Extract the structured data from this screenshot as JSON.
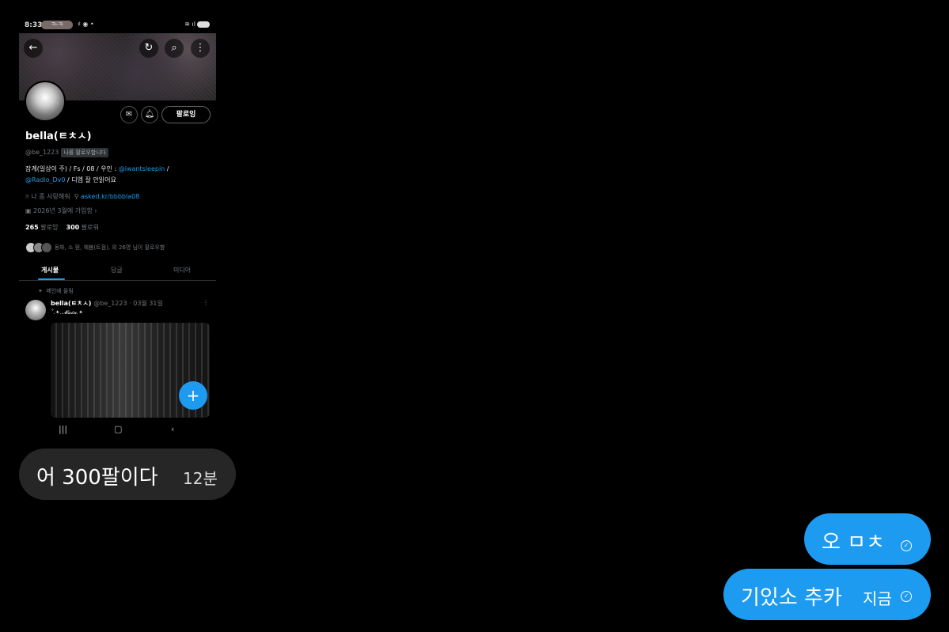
{
  "status_bar": {
    "time": "8:33",
    "pill_text": "ㅋ-ㅋ",
    "battery": "59"
  },
  "profile": {
    "name": "bella(ㅌㅊㅅ)",
    "handle": "@be_1223",
    "follows_you": "나를 팔로우합니다",
    "follow_button": "팔로잉",
    "bio_line1_prefix": "잡계(일상이 주) / Fs / 08 / 우인 :",
    "bio_link1": "@iwantsleepin",
    "bio_line1_suffix": "/",
    "bio_link2": "@Radio_Dv0",
    "bio_line2_suffix": "/ 디엠 잘 안읽어요",
    "location": "나 좀 사랑해줘",
    "website": "asked.kr/bbbbla08",
    "joined": "2026년 3월에 가입함",
    "following_count": "265",
    "following_label": "팔로잉",
    "followers_count": "300",
    "followers_label": "팔로워",
    "mutual_text": "동봐, 소 뭔, 혜봄(트점), 외 26명 님이 팔로우함"
  },
  "tabs": {
    "posts": "게시물",
    "replies": "답글",
    "media": "미디어"
  },
  "post": {
    "pinned_label": "메인에 올림",
    "author": "bella(ㅌㅊㅅ)",
    "meta": "@be_1223 · 03월 31일",
    "text": "˚.✦.𝓜𝓪𝓲𝓷.✦"
  },
  "chat": {
    "received": {
      "text": "어 300팔이다",
      "time": "12분"
    },
    "sent": [
      {
        "text": "오 ㅁㅊ",
        "time": ""
      },
      {
        "text": "기있소 추카",
        "time": "지금"
      }
    ]
  }
}
